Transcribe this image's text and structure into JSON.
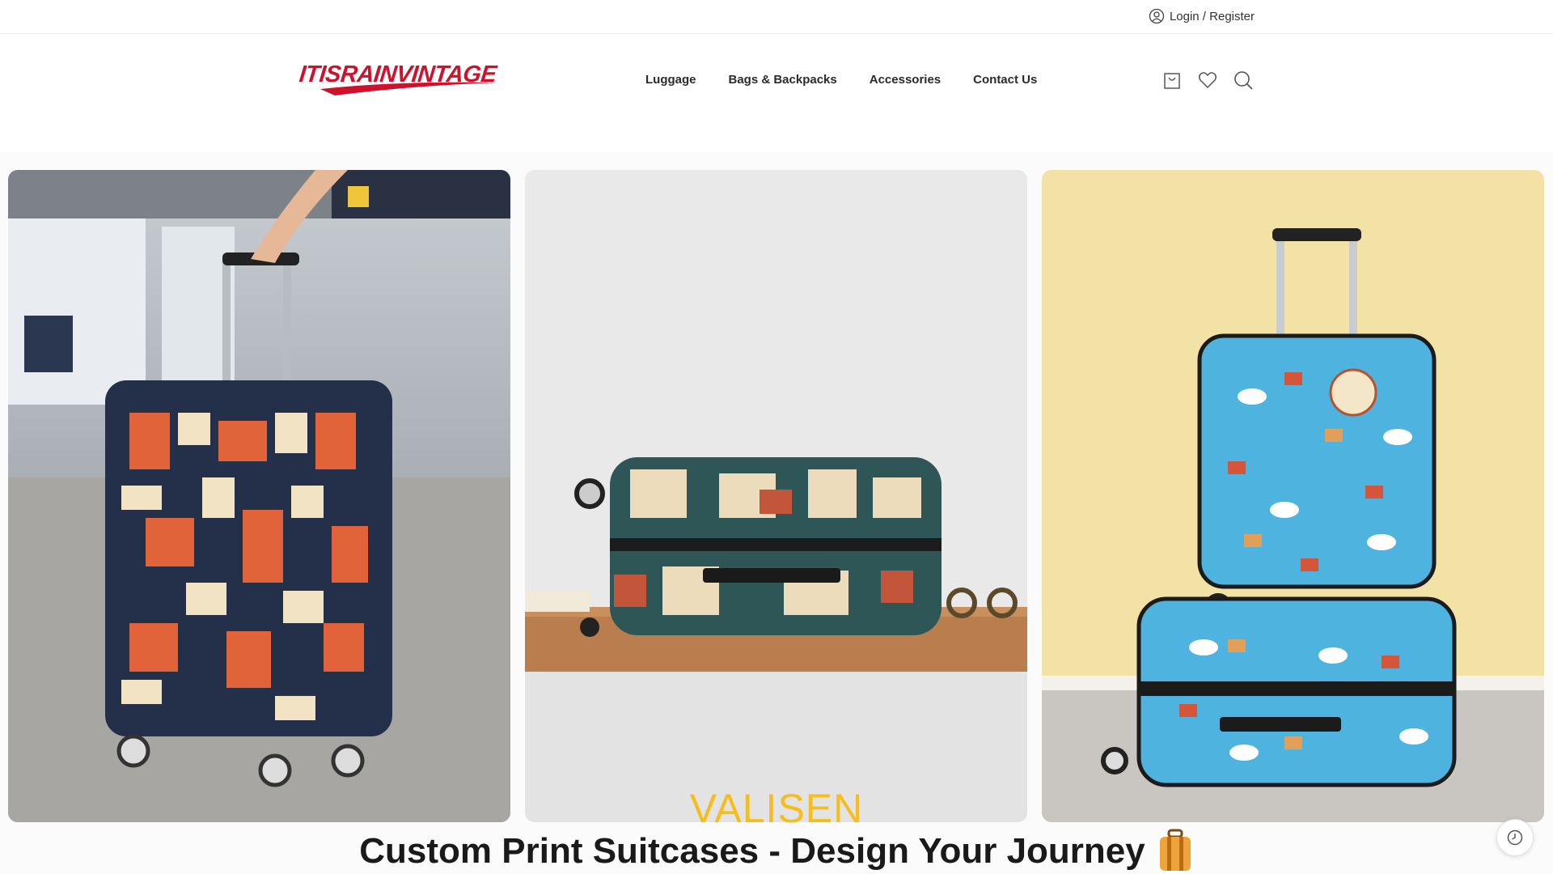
{
  "topbar": {
    "login_label": "Login / Register",
    "login_icon": "user-icon"
  },
  "header": {
    "logo_text": "ITISRAINVINTAGE",
    "brand_color": "#d0112b",
    "nav": [
      {
        "label": "Luggage"
      },
      {
        "label": "Bags & Backpacks"
      },
      {
        "label": "Accessories"
      },
      {
        "label": "Contact Us"
      }
    ],
    "icons": [
      "cart-icon",
      "heart-icon",
      "search-icon"
    ]
  },
  "hero": {
    "images": [
      {
        "name": "geometric-print-suitcase-airport"
      },
      {
        "name": "vintage-stamp-print-suitcase-shelf"
      },
      {
        "name": "cartoon-print-blue-suitcases"
      }
    ],
    "watermark_text": "VALISEN",
    "title": "Custom Print Suitcases - Design Your Journey",
    "title_icon": "suitcase-icon",
    "accent_color": "#f5be1e"
  },
  "floating": {
    "history_icon": "history-icon"
  }
}
